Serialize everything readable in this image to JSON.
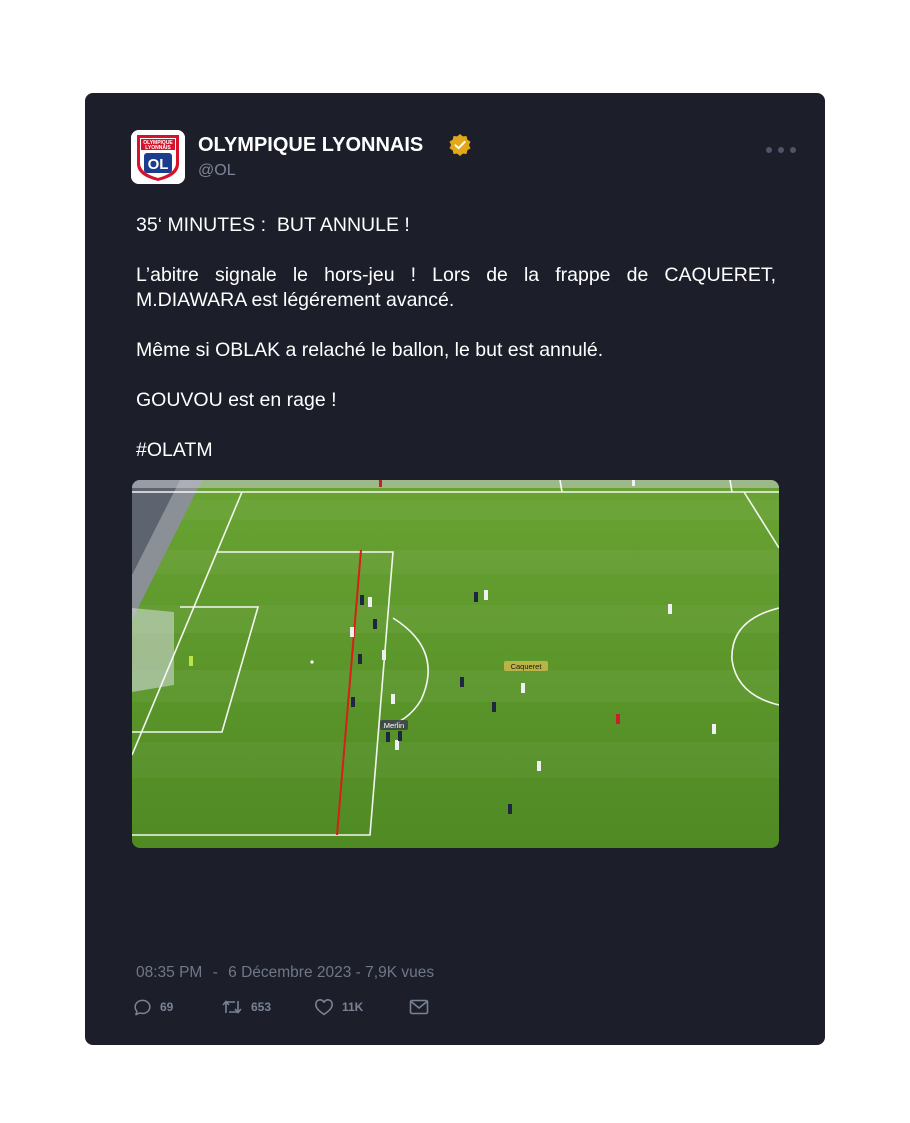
{
  "account": {
    "name": "OLYMPIQUE LYONNAIS",
    "handle": "@OL",
    "logo_top": "OLYMPIQUE",
    "logo_bottom": "LYONNAIS",
    "logo_initials": "OL"
  },
  "tweet": {
    "paragraphs": [
      "35‘ MINUTES :  BUT ANNULE !",
      "L’abitre signale le hors-jeu ! Lors de la frappe de CAQUERET, M.DIAWARA est légérement avancé.",
      "Même si OBLAK a relaché le ballon, le but est annulé.",
      "GOUVOU est en rage !",
      "#OLATM"
    ]
  },
  "media": {
    "labels": [
      "Caqueret",
      "Merlin"
    ],
    "pitch_color": "#5f9a2c",
    "offside_line_color": "#d91e18"
  },
  "meta": {
    "time": "08:35 PM",
    "separator": "-",
    "date_views": "6 Décembre 2023 - 7,9K vues"
  },
  "actions": {
    "replies": "69",
    "retweets": "653",
    "likes": "11K"
  },
  "colors": {
    "card_bg": "#1c1f29",
    "verified": "#e0a81a",
    "muted_text": "#6f7789"
  },
  "icons": [
    "verified-badge-icon",
    "more-icon",
    "reply-icon",
    "retweet-icon",
    "like-icon",
    "share-icon"
  ]
}
